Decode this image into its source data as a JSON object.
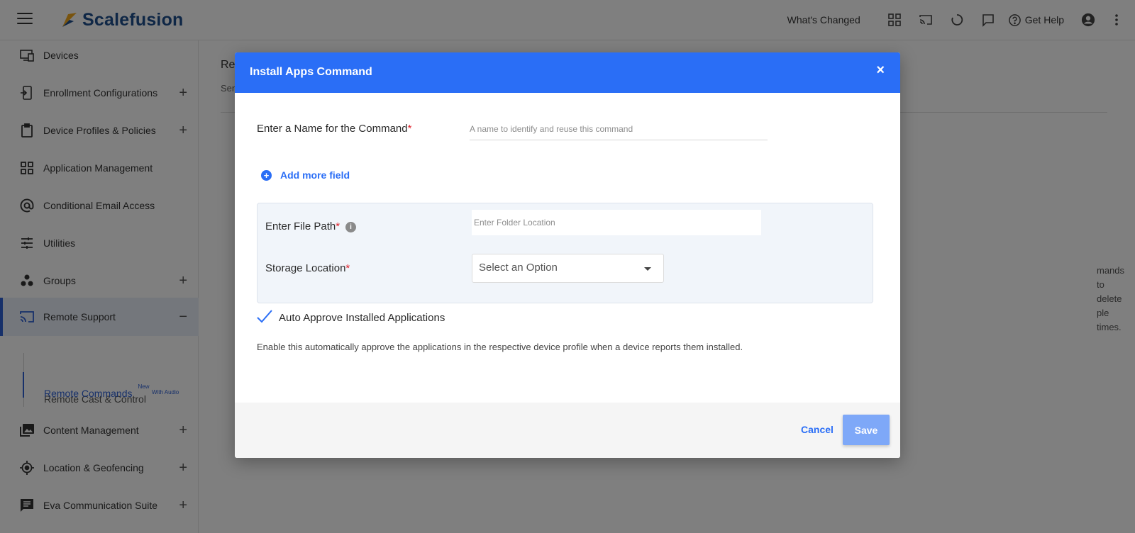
{
  "header": {
    "brand": "Scalefusion",
    "whats_changed": "What's Changed",
    "get_help": "Get Help",
    "icons": [
      "menu-icon",
      "apps-grid-icon",
      "cast-icon",
      "refresh-icon",
      "chat-icon",
      "help-icon",
      "account-icon",
      "more-vert-icon"
    ]
  },
  "sidebar": {
    "items": [
      {
        "label": "Devices",
        "icon": "devices-icon",
        "expandable": false
      },
      {
        "label": "Enrollment Configurations",
        "icon": "enrollment-icon",
        "expandable": true,
        "toggle": "+"
      },
      {
        "label": "Device Profiles & Policies",
        "icon": "clipboard-icon",
        "expandable": true,
        "toggle": "+"
      },
      {
        "label": "Application Management",
        "icon": "apps-grid-icon",
        "expandable": false
      },
      {
        "label": "Conditional Email Access",
        "icon": "at-sign-icon",
        "expandable": false
      },
      {
        "label": "Utilities",
        "icon": "sliders-icon",
        "expandable": false
      },
      {
        "label": "Groups",
        "icon": "groups-icon",
        "expandable": true,
        "toggle": "+"
      },
      {
        "label": "Remote Support",
        "icon": "cast-icon",
        "expandable": true,
        "toggle": "−"
      },
      {
        "label": "Content Management",
        "icon": "photo-library-icon",
        "expandable": true,
        "toggle": "+"
      },
      {
        "label": "Location & Geofencing",
        "icon": "location-icon",
        "expandable": true,
        "toggle": "+"
      },
      {
        "label": "Eva Communication Suite",
        "icon": "message-icon",
        "expandable": true,
        "toggle": "+"
      }
    ],
    "subitems": [
      {
        "label": "Remote Cast & Control",
        "badge": "With Audio"
      },
      {
        "label": "Remote Commands",
        "badge": "New"
      }
    ]
  },
  "background": {
    "title_partial": "Re",
    "subtitle_partial": "Sen",
    "text_partial_line1": "mands to delete",
    "text_partial_line2": "ple times."
  },
  "modal": {
    "title": "Install Apps Command",
    "close": "×",
    "name_label": "Enter a Name for the Command",
    "required_mark": "*",
    "name_placeholder": "A name to identify and reuse this command",
    "add_more_field": "Add more field",
    "file_path_label": "Enter File Path",
    "file_path_placeholder": "Enter Folder Location",
    "info_glyph": "i",
    "storage_label": "Storage Location",
    "storage_value": "Select an Option",
    "auto_approve_label": "Auto Approve Installed Applications",
    "auto_approve_checked": true,
    "hint": "Enable this automatically approve the applications in the respective device profile when a device reports them installed.",
    "cancel": "Cancel",
    "save": "Save"
  },
  "colors": {
    "primary": "#2a6ef6",
    "sidebar_active": "#2f61d5",
    "required": "#e0242e",
    "save_disabled": "#7ea8f8",
    "brand_text": "#1f4e8c"
  }
}
